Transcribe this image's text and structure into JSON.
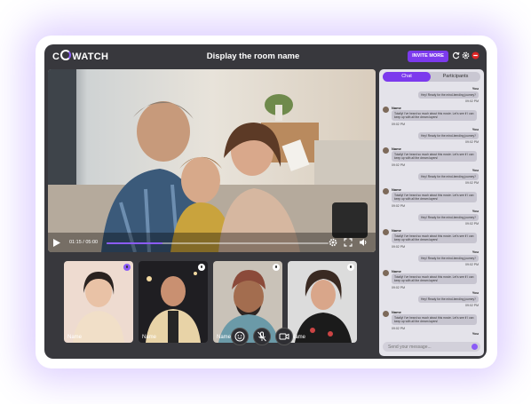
{
  "app": {
    "logo_prefix": "C",
    "logo_suffix": "WATCH",
    "room_title": "Display the room name",
    "invite_label": "INVITE MORE"
  },
  "player": {
    "time": "01:15 / 05:00",
    "progress_fraction": 0.25
  },
  "participants": [
    {
      "name": "Name",
      "speaking": true
    },
    {
      "name": "Name",
      "speaking": false
    },
    {
      "name": "Name",
      "speaking": false
    },
    {
      "name": "Name",
      "speaking": false
    }
  ],
  "call_controls": {
    "icons": [
      "emoji-icon",
      "mic-off-icon",
      "camera-icon"
    ]
  },
  "chat": {
    "tabs": [
      "Chat",
      "Participants"
    ],
    "active_tab": "Chat",
    "you_label": "You",
    "you_message": "Hey! Ready for the mind-bending journey?",
    "their_name": "Name",
    "their_message": "Totally! I've heard so much about this movie. Let's see if I can keep up with all the dream layers!",
    "time": "09:02 PM",
    "input_placeholder": "Send your message..."
  },
  "colors": {
    "accent": "#7c3aed",
    "app_bg": "#38383d",
    "chat_bg": "#e4e3ea",
    "glow": "#8c5aff"
  }
}
